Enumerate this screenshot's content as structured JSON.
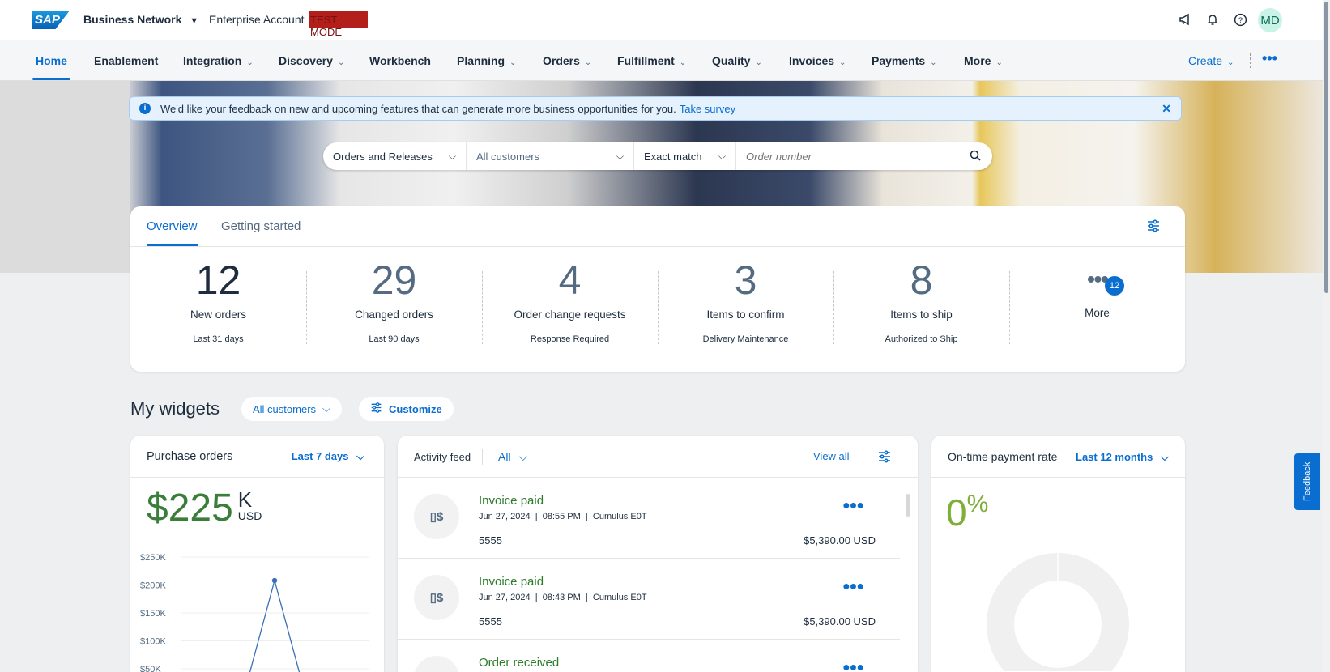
{
  "topbar": {
    "brand": "SAP",
    "product": "Business Network",
    "account": "Enterprise Account",
    "mode_badge": "TEST MODE",
    "avatar": "MD",
    "icons": [
      "megaphone-icon",
      "bell-icon",
      "help-icon"
    ]
  },
  "nav": {
    "items": [
      "Home",
      "Enablement",
      "Integration",
      "Discovery",
      "Workbench",
      "Planning",
      "Orders",
      "Fulfillment",
      "Quality",
      "Invoices",
      "Payments",
      "More"
    ],
    "create": "Create"
  },
  "banner": {
    "text": "We'd like your feedback on new and upcoming features that can generate more business opportunities for you.",
    "link": "Take survey"
  },
  "search": {
    "type": "Orders and Releases",
    "customer": "All customers",
    "match": "Exact match",
    "placeholder": "Order number"
  },
  "overview": {
    "tabs": [
      "Overview",
      "Getting started"
    ],
    "kpis": [
      {
        "num": "12",
        "label": "New orders",
        "sub": "Last 31 days"
      },
      {
        "num": "29",
        "label": "Changed orders",
        "sub": "Last 90 days"
      },
      {
        "num": "4",
        "label": "Order change requests",
        "sub": "Response Required"
      },
      {
        "num": "3",
        "label": "Items to confirm",
        "sub": "Delivery Maintenance"
      },
      {
        "num": "8",
        "label": "Items to ship",
        "sub": "Authorized to Ship"
      }
    ],
    "more": {
      "label": "More",
      "badge": "12"
    }
  },
  "widgets": {
    "title": "My widgets",
    "customer_filter": "All customers",
    "customize": "Customize"
  },
  "purchase_orders": {
    "title": "Purchase orders",
    "period": "Last 7 days",
    "value": "$225",
    "unit": "K",
    "currency": "USD",
    "chart_data": {
      "type": "line",
      "yticks": [
        "$250K",
        "$200K",
        "$150K",
        "$100K",
        "$50K"
      ],
      "ylim": [
        0,
        250
      ],
      "values": [
        0,
        0,
        0,
        208,
        0,
        0,
        0
      ],
      "grid": true
    }
  },
  "activity": {
    "title": "Activity feed",
    "filter": "All",
    "view_all": "View all",
    "items": [
      {
        "title": "Invoice paid",
        "date": "Jun 27, 2024",
        "time": "08:55 PM",
        "customer": "Cumulus E0T",
        "number": "5555",
        "amount": "$5,390.00 USD"
      },
      {
        "title": "Invoice paid",
        "date": "Jun 27, 2024",
        "time": "08:43 PM",
        "customer": "Cumulus E0T",
        "number": "5555",
        "amount": "$5,390.00 USD"
      },
      {
        "title": "Order received"
      }
    ]
  },
  "payment": {
    "title": "On-time payment rate",
    "period": "Last 12 months",
    "value": "0",
    "unit": "%",
    "rate": 0
  },
  "feedback_tab": "Feedback",
  "colors": {
    "accent": "#0a6ed1",
    "positive": "#2b7d2b",
    "test_mode": "#b3201c"
  }
}
